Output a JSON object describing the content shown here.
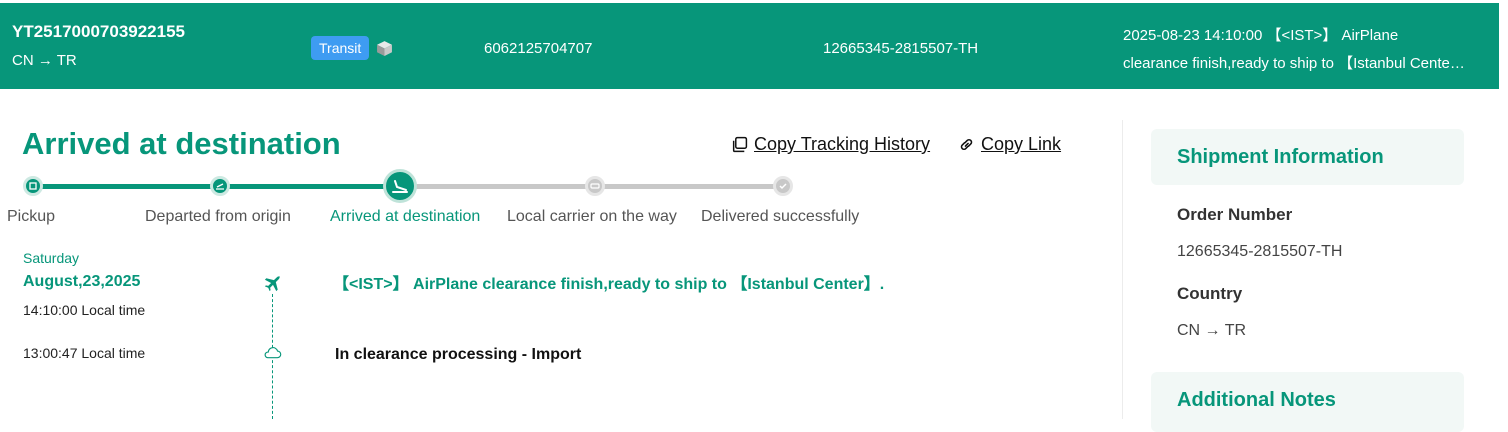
{
  "banner": {
    "tracking_number": "YT2517000703922155",
    "route": "CN → TR",
    "status_badge": "Transit",
    "reference_number": "6062125704707",
    "order_number": "12665345-2815507-TH",
    "latest_event_line1": "2025-08-23 14:10:00 【<IST>】 AirPlane",
    "latest_event_line2": "clearance finish,ready to ship to 【Istanbul Center】.",
    "background_color": "#07967a",
    "badge_color": "#3e9cf2"
  },
  "main": {
    "status_title": "Arrived at destination",
    "copy_history_label": "Copy Tracking History",
    "copy_link_label": "Copy Link",
    "accent_color": "#07967a"
  },
  "progress": {
    "steps": [
      {
        "label": "Pickup",
        "state": "done",
        "icon": "box-icon"
      },
      {
        "label": "Departed from origin",
        "state": "done",
        "icon": "plane-takeoff-icon"
      },
      {
        "label": "Arrived at destination",
        "state": "current",
        "icon": "plane-landing-icon"
      },
      {
        "label": "Local carrier on the way",
        "state": "pending",
        "icon": "truck-icon"
      },
      {
        "label": "Delivered successfully",
        "state": "pending",
        "icon": "check-icon"
      }
    ]
  },
  "timeline": {
    "weekday": "Saturday",
    "date": "August,23,2025",
    "events": [
      {
        "time": "14:10:00 Local time",
        "text": "【<IST>】 AirPlane clearance finish,ready to ship to 【Istanbul Center】.",
        "icon": "plane-icon"
      },
      {
        "time": "13:00:47 Local time",
        "text": "In clearance processing - Import",
        "icon": "cloud-icon"
      }
    ]
  },
  "shipment_info": {
    "heading": "Shipment Information",
    "order_number_label": "Order Number",
    "order_number_value": "12665345-2815507-TH",
    "country_label": "Country",
    "country_value": "CN → TR"
  },
  "additional_notes": {
    "heading": "Additional Notes"
  }
}
